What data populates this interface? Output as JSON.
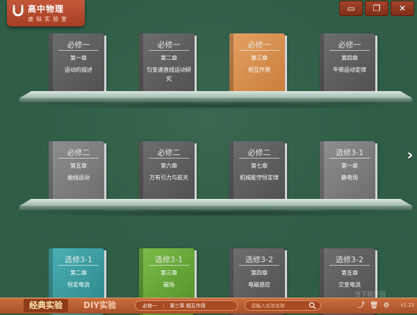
{
  "app": {
    "title": "高中物理",
    "subtitle": "虚拟实验室"
  },
  "window_controls": {
    "minimize": "▭",
    "restore": "❐",
    "close": "✕"
  },
  "shelves": [
    {
      "books": [
        {
          "series": "必修一",
          "chapter": "第一章",
          "title": "运动的描述",
          "color": "dark"
        },
        {
          "series": "必修一",
          "chapter": "第二章",
          "title": "匀变速直线运动研究",
          "color": "dark"
        },
        {
          "series": "必修一",
          "chapter": "第三章",
          "title": "相互作用",
          "color": "orange"
        },
        {
          "series": "必修一",
          "chapter": "第四章",
          "title": "牛顿运动定律",
          "color": "dark"
        }
      ]
    },
    {
      "books": [
        {
          "series": "必修二",
          "chapter": "第五章",
          "title": "曲线运动",
          "color": "light"
        },
        {
          "series": "必修二",
          "chapter": "第六章",
          "title": "万有引力与航天",
          "color": "dark"
        },
        {
          "series": "必修二",
          "chapter": "第七章",
          "title": "机械能守恒定律",
          "color": "dark"
        },
        {
          "series": "选修3-1",
          "chapter": "第一章",
          "title": "静电场",
          "color": "light"
        }
      ]
    },
    {
      "books": [
        {
          "series": "选修3-1",
          "chapter": "第二章",
          "title": "恒定电流",
          "color": "teal"
        },
        {
          "series": "选修3-1",
          "chapter": "第三章",
          "title": "磁场",
          "color": "green"
        },
        {
          "series": "选修3-2",
          "chapter": "第四章",
          "title": "电磁感应",
          "color": "dark"
        },
        {
          "series": "选修3-2",
          "chapter": "第五章",
          "title": "交变电流",
          "color": "dark"
        }
      ]
    }
  ],
  "bottom_bar": {
    "tab_classic": "经典实验",
    "tab_diy": "DIY实验",
    "breadcrumb_book": "必修一",
    "breadcrumb_chapter": "第三章 相互作用",
    "search_placeholder": "请输入实验名称",
    "version": "v1.23",
    "watermark": "当下软件园"
  },
  "icons": {
    "next": "chevron-right-icon",
    "share": "share-icon",
    "trash": "trash-icon",
    "settings": "gear-icon"
  },
  "colors": {
    "board": "#2e5c45",
    "bar": "#b85a30",
    "active_book": "#d98e4e"
  }
}
